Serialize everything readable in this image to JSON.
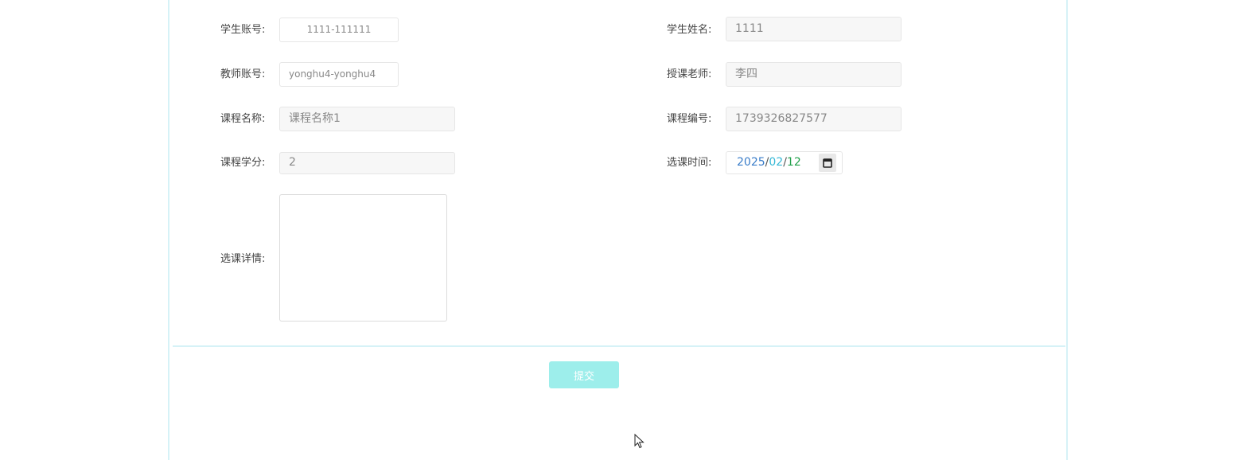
{
  "form": {
    "student_account": {
      "label": "学生账号:",
      "value": "1111-111111"
    },
    "student_name": {
      "label": "学生姓名:",
      "value": "1111"
    },
    "teacher_account": {
      "label": "教师账号:",
      "value": "yonghu4-yonghu4"
    },
    "teacher_name": {
      "label": "授课老师:",
      "value": "李四"
    },
    "course_name": {
      "label": "课程名称:",
      "value": "课程名称1"
    },
    "course_code": {
      "label": "课程编号:",
      "value": "1739326827577"
    },
    "course_credit": {
      "label": "课程学分:",
      "value": "2"
    },
    "select_time": {
      "label": "选课时间:",
      "year": "2025",
      "month": "02",
      "day": "12",
      "separator": "/",
      "icon": "calendar-icon"
    },
    "details": {
      "label": "选课详情:",
      "value": ""
    }
  },
  "submit_label": "提交",
  "colors": {
    "border": "#d6f2f7",
    "submit_bg": "#9deeeb",
    "date_year": "#3a7dc9",
    "date_month": "#35b8d6",
    "date_day": "#22a04b"
  }
}
